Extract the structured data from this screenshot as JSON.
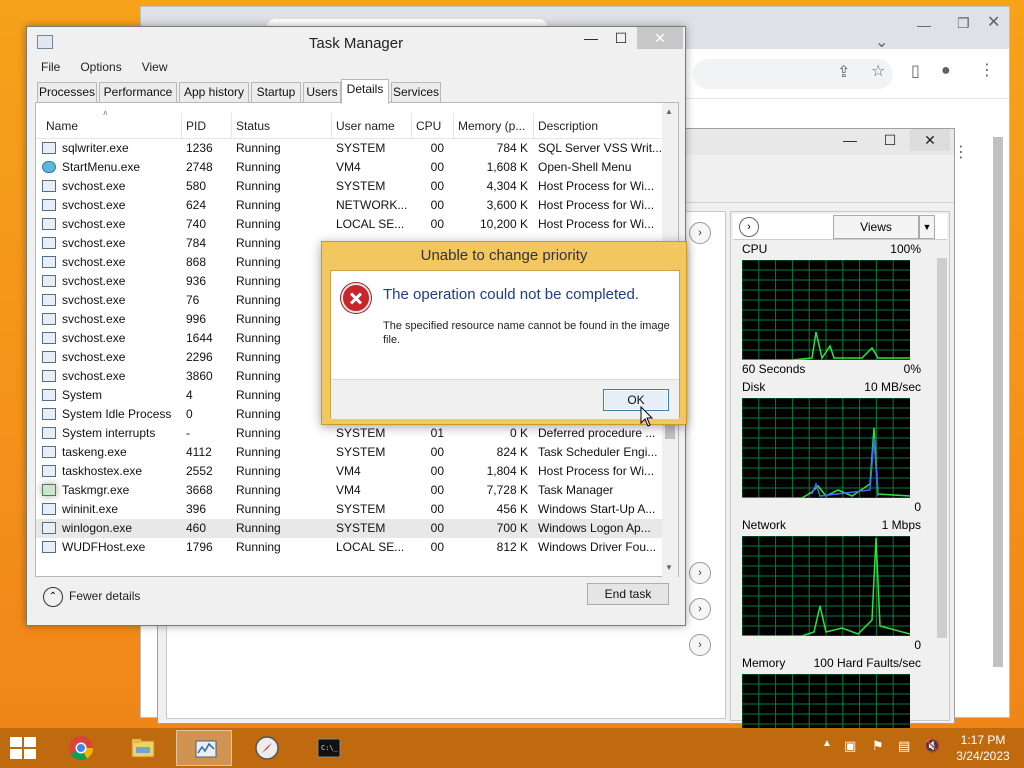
{
  "task_manager": {
    "title": "Task Manager",
    "menu": [
      "File",
      "Options",
      "View"
    ],
    "tabs": [
      "Processes",
      "Performance",
      "App history",
      "Startup",
      "Users",
      "Details",
      "Services"
    ],
    "active_tab": "Details",
    "columns": [
      "Name",
      "PID",
      "Status",
      "User name",
      "CPU",
      "Memory (p...",
      "Description"
    ],
    "processes": [
      {
        "name": "sqlwriter.exe",
        "pid": "1236",
        "status": "Running",
        "user": "SYSTEM",
        "cpu": "00",
        "mem": "784 K",
        "desc": "SQL Server VSS Writ..."
      },
      {
        "name": "StartMenu.exe",
        "pid": "2748",
        "status": "Running",
        "user": "VM4",
        "cpu": "00",
        "mem": "1,608 K",
        "desc": "Open-Shell Menu"
      },
      {
        "name": "svchost.exe",
        "pid": "580",
        "status": "Running",
        "user": "SYSTEM",
        "cpu": "00",
        "mem": "4,304 K",
        "desc": "Host Process for Wi..."
      },
      {
        "name": "svchost.exe",
        "pid": "624",
        "status": "Running",
        "user": "NETWORK...",
        "cpu": "00",
        "mem": "3,600 K",
        "desc": "Host Process for Wi..."
      },
      {
        "name": "svchost.exe",
        "pid": "740",
        "status": "Running",
        "user": "LOCAL SE...",
        "cpu": "00",
        "mem": "10,200 K",
        "desc": "Host Process for Wi..."
      },
      {
        "name": "svchost.exe",
        "pid": "784",
        "status": "Running",
        "user": "",
        "cpu": "",
        "mem": "",
        "desc": ""
      },
      {
        "name": "svchost.exe",
        "pid": "868",
        "status": "Running",
        "user": "",
        "cpu": "",
        "mem": "",
        "desc": ""
      },
      {
        "name": "svchost.exe",
        "pid": "936",
        "status": "Running",
        "user": "",
        "cpu": "",
        "mem": "",
        "desc": ""
      },
      {
        "name": "svchost.exe",
        "pid": "76",
        "status": "Running",
        "user": "",
        "cpu": "",
        "mem": "",
        "desc": ""
      },
      {
        "name": "svchost.exe",
        "pid": "996",
        "status": "Running",
        "user": "",
        "cpu": "",
        "mem": "",
        "desc": ""
      },
      {
        "name": "svchost.exe",
        "pid": "1644",
        "status": "Running",
        "user": "",
        "cpu": "",
        "mem": "",
        "desc": ""
      },
      {
        "name": "svchost.exe",
        "pid": "2296",
        "status": "Running",
        "user": "",
        "cpu": "",
        "mem": "",
        "desc": ""
      },
      {
        "name": "svchost.exe",
        "pid": "3860",
        "status": "Running",
        "user": "",
        "cpu": "",
        "mem": "",
        "desc": ""
      },
      {
        "name": "System",
        "pid": "4",
        "status": "Running",
        "user": "",
        "cpu": "",
        "mem": "",
        "desc": ""
      },
      {
        "name": "System Idle Process",
        "pid": "0",
        "status": "Running",
        "user": "",
        "cpu": "",
        "mem": "",
        "desc": ""
      },
      {
        "name": "System interrupts",
        "pid": "-",
        "status": "Running",
        "user": "SYSTEM",
        "cpu": "01",
        "mem": "0 K",
        "desc": "Deferred procedure ..."
      },
      {
        "name": "taskeng.exe",
        "pid": "4112",
        "status": "Running",
        "user": "SYSTEM",
        "cpu": "00",
        "mem": "824 K",
        "desc": "Task Scheduler Engi..."
      },
      {
        "name": "taskhostex.exe",
        "pid": "2552",
        "status": "Running",
        "user": "VM4",
        "cpu": "00",
        "mem": "1,804 K",
        "desc": "Host Process for Wi..."
      },
      {
        "name": "Taskmgr.exe",
        "pid": "3668",
        "status": "Running",
        "user": "VM4",
        "cpu": "00",
        "mem": "7,728 K",
        "desc": "Task Manager"
      },
      {
        "name": "wininit.exe",
        "pid": "396",
        "status": "Running",
        "user": "SYSTEM",
        "cpu": "00",
        "mem": "456 K",
        "desc": "Windows Start-Up A..."
      },
      {
        "name": "winlogon.exe",
        "pid": "460",
        "status": "Running",
        "user": "SYSTEM",
        "cpu": "00",
        "mem": "700 K",
        "desc": "Windows Logon Ap..."
      },
      {
        "name": "WUDFHost.exe",
        "pid": "1796",
        "status": "Running",
        "user": "LOCAL SE...",
        "cpu": "00",
        "mem": "812 K",
        "desc": "Windows Driver Fou..."
      }
    ],
    "selected_index": 20,
    "fewer_details": "Fewer details",
    "end_task": "End task"
  },
  "dialog": {
    "title": "Unable to change priority",
    "main": "The operation could not be completed.",
    "detail": "The specified resource name cannot be found in the image file.",
    "ok": "OK"
  },
  "resource_monitor": {
    "views": "Views",
    "panels": [
      {
        "label": "CPU",
        "value": "100%",
        "bottom_left": "60 Seconds",
        "bottom_right": "0%"
      },
      {
        "label": "Disk",
        "value": "10 MB/sec",
        "bottom_left": "",
        "bottom_right": "0"
      },
      {
        "label": "Network",
        "value": "1 Mbps",
        "bottom_left": "",
        "bottom_right": "0"
      },
      {
        "label": "Memory",
        "value": "100 Hard Faults/sec",
        "bottom_left": "",
        "bottom_right": ""
      }
    ]
  },
  "taskbar": {
    "time": "1:17 PM",
    "date": "3/24/2023",
    "apps": [
      "chrome-icon",
      "file-explorer-icon",
      "resource-monitor-icon",
      "compass-icon",
      "command-prompt-icon"
    ]
  },
  "colors": {
    "accent": "#f39a1a",
    "graph_bg": "#000000",
    "graph_grid": "#0b7d3a",
    "graph_line": "#2fe33a",
    "disk_line": "#3d6bff",
    "dialog_frame": "#f2c760"
  }
}
